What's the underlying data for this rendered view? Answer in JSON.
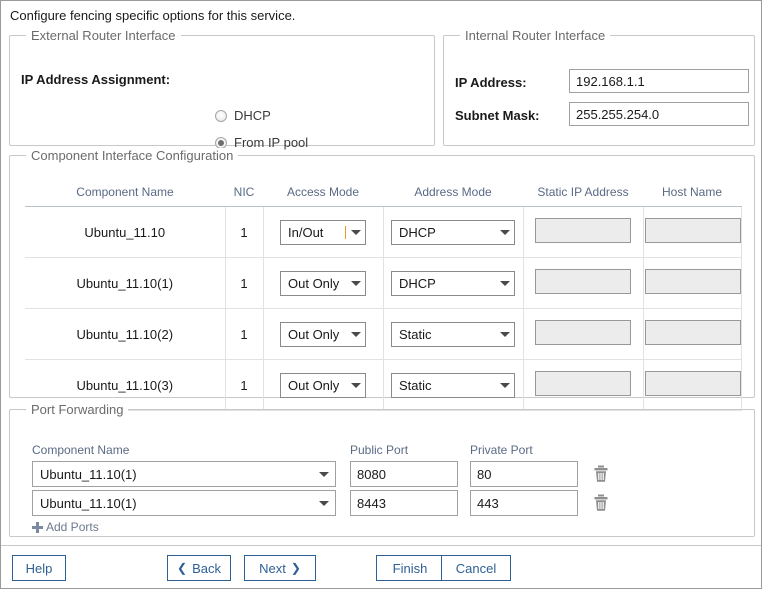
{
  "intro": "Configure fencing specific options for this service.",
  "external_router": {
    "legend": "External Router Interface",
    "ip_assignment_label": "IP Address Assignment:",
    "options": [
      {
        "label": "DHCP",
        "selected": false
      },
      {
        "label": "From IP pool",
        "selected": true
      }
    ]
  },
  "internal_router": {
    "legend": "Internal Router Interface",
    "ip_address_label": "IP Address:",
    "ip_address_value": "192.168.1.1",
    "subnet_mask_label": "Subnet Mask:",
    "subnet_mask_value": "255.255.254.0"
  },
  "component_interface": {
    "legend": "Component Interface Configuration",
    "columns": [
      "Component Name",
      "NIC",
      "Access Mode",
      "Address Mode",
      "Static IP Address",
      "Host Name"
    ],
    "rows": [
      {
        "component_name": "Ubuntu_11.10",
        "nic": "1",
        "access_mode": "In/Out",
        "address_mode": "DHCP",
        "static_ip": "",
        "host_name": ""
      },
      {
        "component_name": "Ubuntu_11.10(1)",
        "nic": "1",
        "access_mode": "Out Only",
        "address_mode": "DHCP",
        "static_ip": "",
        "host_name": ""
      },
      {
        "component_name": "Ubuntu_11.10(2)",
        "nic": "1",
        "access_mode": "Out Only",
        "address_mode": "Static",
        "static_ip": "",
        "host_name": ""
      },
      {
        "component_name": "Ubuntu_11.10(3)",
        "nic": "1",
        "access_mode": "Out Only",
        "address_mode": "Static",
        "static_ip": "",
        "host_name": ""
      }
    ]
  },
  "port_forwarding": {
    "legend": "Port Forwarding",
    "headers": {
      "component_name": "Component Name",
      "public_port": "Public Port",
      "private_port": "Private Port"
    },
    "rows": [
      {
        "component_name": "Ubuntu_11.10(1)",
        "public_port": "8080",
        "private_port": "80"
      },
      {
        "component_name": "Ubuntu_11.10(1)",
        "public_port": "8443",
        "private_port": "443"
      }
    ],
    "add_ports_label": "Add Ports"
  },
  "footer": {
    "help": "Help",
    "back": "Back",
    "next": "Next",
    "finish": "Finish",
    "cancel": "Cancel",
    "back_chevron": "❮",
    "next_chevron": "❯"
  },
  "colors": {
    "button_blue": "#2f6094",
    "header_text": "#5a6a85",
    "legend_text": "#6b6b6b",
    "caret_focus": "#e8992b",
    "disabled_field": "#ececec"
  }
}
